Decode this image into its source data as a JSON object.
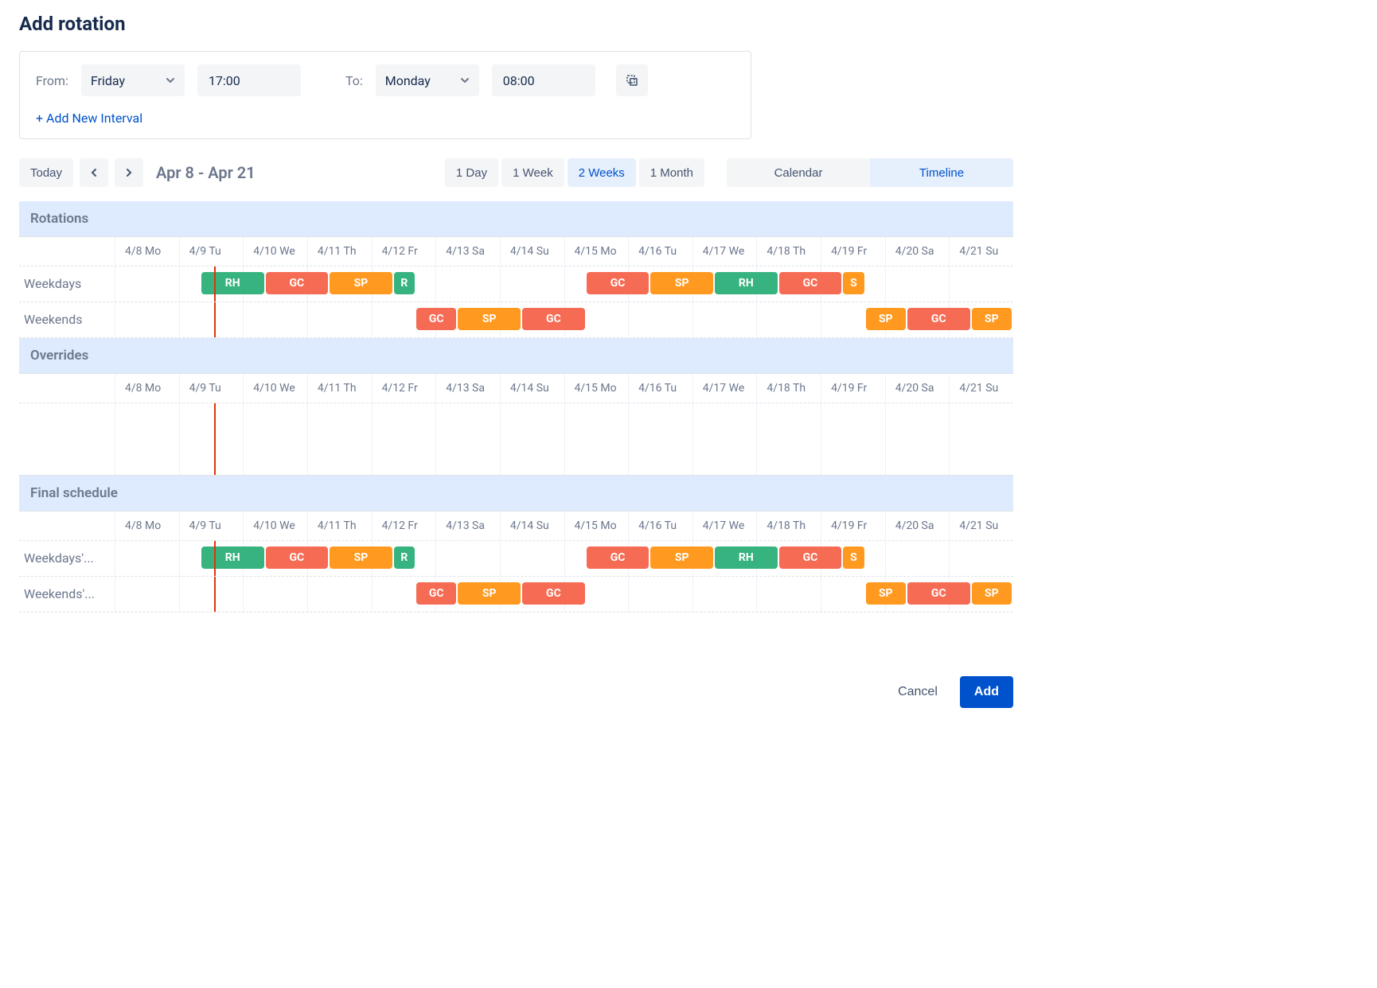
{
  "title": "Add rotation",
  "interval": {
    "from_label": "From:",
    "from_day": "Friday",
    "from_time": "17:00",
    "to_label": "To:",
    "to_day": "Monday",
    "to_time": "08:00"
  },
  "add_interval_label": "+ Add New Interval",
  "toolbar": {
    "today": "Today",
    "range": "Apr 8 - Apr 21",
    "periods": {
      "day": "1 Day",
      "week": "1 Week",
      "twoweeks": "2 Weeks",
      "month": "1 Month"
    },
    "active_period": "twoweeks",
    "views": {
      "calendar": "Calendar",
      "timeline": "Timeline"
    },
    "active_view": "timeline"
  },
  "days": [
    "4/8 Mo",
    "4/9 Tu",
    "4/10 We",
    "4/11 Th",
    "4/12 Fr",
    "4/13 Sa",
    "4/14 Su",
    "4/15 Mo",
    "4/16 Tu",
    "4/17 We",
    "4/18 Th",
    "4/19 Fr",
    "4/20 Sa",
    "4/21 Su"
  ],
  "now_day_fraction": 1.55,
  "sections": {
    "rotations": "Rotations",
    "overrides": "Overrides",
    "final": "Final schedule"
  },
  "rows": {
    "weekdays": "Weekdays",
    "weekends": "Weekends",
    "final_weekdays": "Weekdays'...",
    "final_weekends": "Weekends'..."
  },
  "people": {
    "RH": {
      "label": "RH",
      "color": "c-green"
    },
    "GC": {
      "label": "GC",
      "color": "c-coral"
    },
    "SP": {
      "label": "SP",
      "color": "c-orange2"
    },
    "R": {
      "label": "R",
      "color": "c-green"
    },
    "S": {
      "label": "S",
      "color": "c-orange2"
    }
  },
  "shifts": {
    "weekdays": [
      {
        "p": "RH",
        "start": 1.35,
        "end": 2.35
      },
      {
        "p": "GC",
        "start": 2.35,
        "end": 3.35
      },
      {
        "p": "SP",
        "start": 3.35,
        "end": 4.35
      },
      {
        "p": "R",
        "start": 4.35,
        "end": 4.7
      },
      {
        "p": "GC",
        "start": 7.35,
        "end": 8.35
      },
      {
        "p": "SP",
        "start": 8.35,
        "end": 9.35
      },
      {
        "p": "RH",
        "start": 9.35,
        "end": 10.35
      },
      {
        "p": "GC",
        "start": 10.35,
        "end": 11.35
      },
      {
        "p": "S",
        "start": 11.35,
        "end": 11.7
      }
    ],
    "weekends": [
      {
        "p": "GC",
        "start": 4.7,
        "end": 5.35
      },
      {
        "p": "SP",
        "start": 5.35,
        "end": 6.35
      },
      {
        "p": "GC",
        "start": 6.35,
        "end": 7.35
      },
      {
        "p": "SP",
        "start": 11.7,
        "end": 12.35
      },
      {
        "p": "GC",
        "start": 12.35,
        "end": 13.35
      },
      {
        "p": "SP",
        "start": 13.35,
        "end": 14.0
      }
    ]
  },
  "footer": {
    "cancel": "Cancel",
    "add": "Add"
  }
}
